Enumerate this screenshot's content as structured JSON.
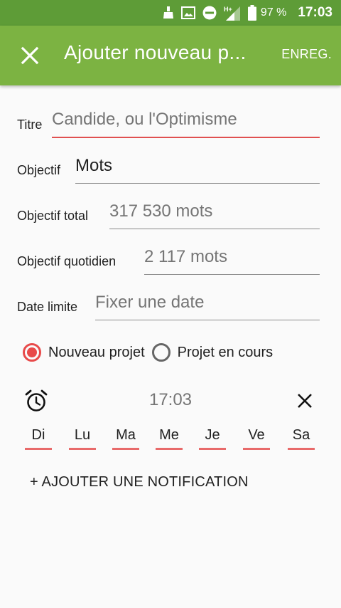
{
  "status_bar": {
    "battery_percent": "97 %",
    "time": "17:03",
    "network": "H+",
    "icons": [
      "cleaner-icon",
      "image-icon",
      "do-not-disturb-icon",
      "signal-icon",
      "battery-icon"
    ]
  },
  "app_bar": {
    "title": "Ajouter nouveau p...",
    "save_label": "ENREG.",
    "close_icon": "close-icon"
  },
  "form": {
    "title": {
      "label": "Titre",
      "placeholder": "Candide, ou l'Optimisme"
    },
    "objective": {
      "label": "Objectif",
      "value": "Mots"
    },
    "total": {
      "label": "Objectif total",
      "placeholder": "317 530 mots"
    },
    "daily": {
      "label": "Objectif quotidien",
      "placeholder": "2 117 mots"
    },
    "deadline": {
      "label": "Date limite",
      "placeholder": "Fixer une date"
    }
  },
  "project_type": {
    "options": [
      "Nouveau projet",
      "Projet en cours"
    ],
    "selected": "Nouveau projet"
  },
  "notification": {
    "time": "17:03",
    "days": [
      "Di",
      "Lu",
      "Ma",
      "Me",
      "Je",
      "Ve",
      "Sa"
    ],
    "add_label": "+ AJOUTER UNE NOTIFICATION"
  },
  "colors": {
    "status_bar": "#5e9c37",
    "app_bar": "#7cb342",
    "accent": "#e84a4a"
  }
}
